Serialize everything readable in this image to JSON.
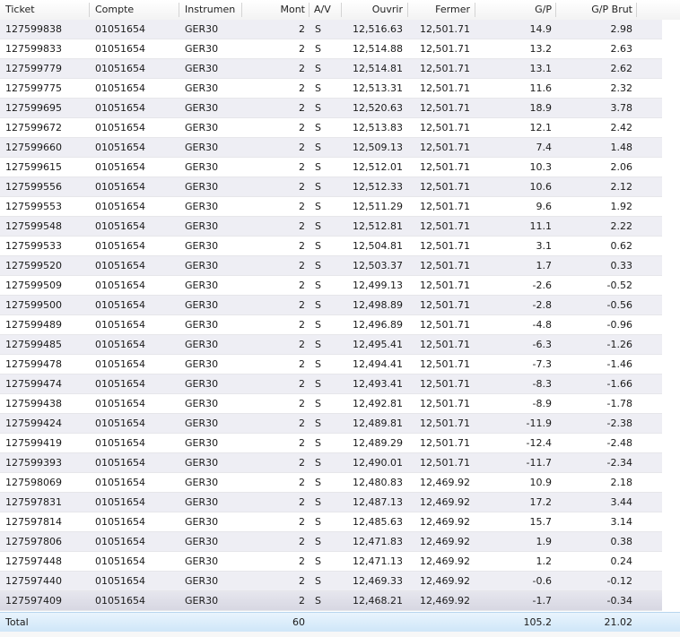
{
  "columns": {
    "ticket": "Ticket",
    "account": "Compte",
    "instrument": "Instrumen",
    "amount": "Mont",
    "side": "A/V",
    "open": "Ouvrir",
    "close": "Fermer",
    "pl": "G/P",
    "pl_gross": "G/P Brut"
  },
  "rows": [
    {
      "ticket": "127599838",
      "account": "01051654",
      "instrument": "GER30",
      "amount": "2",
      "side": "S",
      "open": "12,516.63",
      "close": "12,501.71",
      "pl": "14.9",
      "pl_gross": "2.98"
    },
    {
      "ticket": "127599833",
      "account": "01051654",
      "instrument": "GER30",
      "amount": "2",
      "side": "S",
      "open": "12,514.88",
      "close": "12,501.71",
      "pl": "13.2",
      "pl_gross": "2.63"
    },
    {
      "ticket": "127599779",
      "account": "01051654",
      "instrument": "GER30",
      "amount": "2",
      "side": "S",
      "open": "12,514.81",
      "close": "12,501.71",
      "pl": "13.1",
      "pl_gross": "2.62"
    },
    {
      "ticket": "127599775",
      "account": "01051654",
      "instrument": "GER30",
      "amount": "2",
      "side": "S",
      "open": "12,513.31",
      "close": "12,501.71",
      "pl": "11.6",
      "pl_gross": "2.32"
    },
    {
      "ticket": "127599695",
      "account": "01051654",
      "instrument": "GER30",
      "amount": "2",
      "side": "S",
      "open": "12,520.63",
      "close": "12,501.71",
      "pl": "18.9",
      "pl_gross": "3.78"
    },
    {
      "ticket": "127599672",
      "account": "01051654",
      "instrument": "GER30",
      "amount": "2",
      "side": "S",
      "open": "12,513.83",
      "close": "12,501.71",
      "pl": "12.1",
      "pl_gross": "2.42"
    },
    {
      "ticket": "127599660",
      "account": "01051654",
      "instrument": "GER30",
      "amount": "2",
      "side": "S",
      "open": "12,509.13",
      "close": "12,501.71",
      "pl": "7.4",
      "pl_gross": "1.48"
    },
    {
      "ticket": "127599615",
      "account": "01051654",
      "instrument": "GER30",
      "amount": "2",
      "side": "S",
      "open": "12,512.01",
      "close": "12,501.71",
      "pl": "10.3",
      "pl_gross": "2.06"
    },
    {
      "ticket": "127599556",
      "account": "01051654",
      "instrument": "GER30",
      "amount": "2",
      "side": "S",
      "open": "12,512.33",
      "close": "12,501.71",
      "pl": "10.6",
      "pl_gross": "2.12"
    },
    {
      "ticket": "127599553",
      "account": "01051654",
      "instrument": "GER30",
      "amount": "2",
      "side": "S",
      "open": "12,511.29",
      "close": "12,501.71",
      "pl": "9.6",
      "pl_gross": "1.92"
    },
    {
      "ticket": "127599548",
      "account": "01051654",
      "instrument": "GER30",
      "amount": "2",
      "side": "S",
      "open": "12,512.81",
      "close": "12,501.71",
      "pl": "11.1",
      "pl_gross": "2.22"
    },
    {
      "ticket": "127599533",
      "account": "01051654",
      "instrument": "GER30",
      "amount": "2",
      "side": "S",
      "open": "12,504.81",
      "close": "12,501.71",
      "pl": "3.1",
      "pl_gross": "0.62"
    },
    {
      "ticket": "127599520",
      "account": "01051654",
      "instrument": "GER30",
      "amount": "2",
      "side": "S",
      "open": "12,503.37",
      "close": "12,501.71",
      "pl": "1.7",
      "pl_gross": "0.33"
    },
    {
      "ticket": "127599509",
      "account": "01051654",
      "instrument": "GER30",
      "amount": "2",
      "side": "S",
      "open": "12,499.13",
      "close": "12,501.71",
      "pl": "-2.6",
      "pl_gross": "-0.52"
    },
    {
      "ticket": "127599500",
      "account": "01051654",
      "instrument": "GER30",
      "amount": "2",
      "side": "S",
      "open": "12,498.89",
      "close": "12,501.71",
      "pl": "-2.8",
      "pl_gross": "-0.56"
    },
    {
      "ticket": "127599489",
      "account": "01051654",
      "instrument": "GER30",
      "amount": "2",
      "side": "S",
      "open": "12,496.89",
      "close": "12,501.71",
      "pl": "-4.8",
      "pl_gross": "-0.96"
    },
    {
      "ticket": "127599485",
      "account": "01051654",
      "instrument": "GER30",
      "amount": "2",
      "side": "S",
      "open": "12,495.41",
      "close": "12,501.71",
      "pl": "-6.3",
      "pl_gross": "-1.26"
    },
    {
      "ticket": "127599478",
      "account": "01051654",
      "instrument": "GER30",
      "amount": "2",
      "side": "S",
      "open": "12,494.41",
      "close": "12,501.71",
      "pl": "-7.3",
      "pl_gross": "-1.46"
    },
    {
      "ticket": "127599474",
      "account": "01051654",
      "instrument": "GER30",
      "amount": "2",
      "side": "S",
      "open": "12,493.41",
      "close": "12,501.71",
      "pl": "-8.3",
      "pl_gross": "-1.66"
    },
    {
      "ticket": "127599438",
      "account": "01051654",
      "instrument": "GER30",
      "amount": "2",
      "side": "S",
      "open": "12,492.81",
      "close": "12,501.71",
      "pl": "-8.9",
      "pl_gross": "-1.78"
    },
    {
      "ticket": "127599424",
      "account": "01051654",
      "instrument": "GER30",
      "amount": "2",
      "side": "S",
      "open": "12,489.81",
      "close": "12,501.71",
      "pl": "-11.9",
      "pl_gross": "-2.38"
    },
    {
      "ticket": "127599419",
      "account": "01051654",
      "instrument": "GER30",
      "amount": "2",
      "side": "S",
      "open": "12,489.29",
      "close": "12,501.71",
      "pl": "-12.4",
      "pl_gross": "-2.48"
    },
    {
      "ticket": "127599393",
      "account": "01051654",
      "instrument": "GER30",
      "amount": "2",
      "side": "S",
      "open": "12,490.01",
      "close": "12,501.71",
      "pl": "-11.7",
      "pl_gross": "-2.34"
    },
    {
      "ticket": "127598069",
      "account": "01051654",
      "instrument": "GER30",
      "amount": "2",
      "side": "S",
      "open": "12,480.83",
      "close": "12,469.92",
      "pl": "10.9",
      "pl_gross": "2.18"
    },
    {
      "ticket": "127597831",
      "account": "01051654",
      "instrument": "GER30",
      "amount": "2",
      "side": "S",
      "open": "12,487.13",
      "close": "12,469.92",
      "pl": "17.2",
      "pl_gross": "3.44"
    },
    {
      "ticket": "127597814",
      "account": "01051654",
      "instrument": "GER30",
      "amount": "2",
      "side": "S",
      "open": "12,485.63",
      "close": "12,469.92",
      "pl": "15.7",
      "pl_gross": "3.14"
    },
    {
      "ticket": "127597806",
      "account": "01051654",
      "instrument": "GER30",
      "amount": "2",
      "side": "S",
      "open": "12,471.83",
      "close": "12,469.92",
      "pl": "1.9",
      "pl_gross": "0.38"
    },
    {
      "ticket": "127597448",
      "account": "01051654",
      "instrument": "GER30",
      "amount": "2",
      "side": "S",
      "open": "12,471.13",
      "close": "12,469.92",
      "pl": "1.2",
      "pl_gross": "0.24"
    },
    {
      "ticket": "127597440",
      "account": "01051654",
      "instrument": "GER30",
      "amount": "2",
      "side": "S",
      "open": "12,469.33",
      "close": "12,469.92",
      "pl": "-0.6",
      "pl_gross": "-0.12"
    },
    {
      "ticket": "127597409",
      "account": "01051654",
      "instrument": "GER30",
      "amount": "2",
      "side": "S",
      "open": "12,468.21",
      "close": "12,469.92",
      "pl": "-1.7",
      "pl_gross": "-0.34"
    }
  ],
  "selected_row": 29,
  "total": {
    "label": "Total",
    "amount": "60",
    "pl": "105.2",
    "pl_gross": "21.02"
  }
}
